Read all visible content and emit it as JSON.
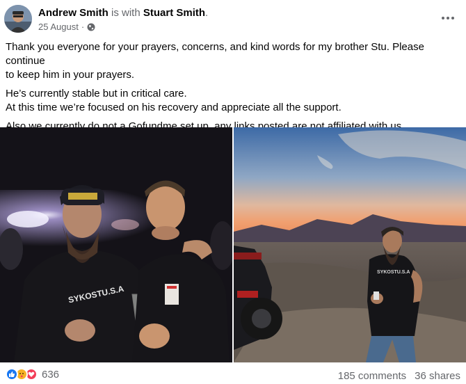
{
  "post": {
    "author": "Andrew Smith",
    "with_word": " is with ",
    "tagged": "Stuart Smith",
    "tagged_suffix": ".",
    "date": "25 August",
    "separator": "·",
    "privacy_icon": "globe-icon",
    "paragraphs": [
      [
        "Thank you everyone for your prayers, concerns, and kind words for my brother Stu. Please continue",
        "to keep him in your prayers."
      ],
      [
        "He’s currently stable but in critical care.",
        "At this time we’re focused on his recovery and appreciate all the support."
      ],
      [
        "Also we currently do not a Gofundme set up, any links posted are not affiliated with us."
      ]
    ],
    "photos": [
      {
        "name": "photo-two-men-night",
        "shirt_text": "SYKOSTU.S.A",
        "hat_text": "MILITARY VETERAN"
      },
      {
        "name": "photo-man-desert-sunset",
        "shirt_text": "SYKOSTU.S.A"
      }
    ]
  },
  "footer": {
    "reaction_count": "636",
    "comments": "185 comments",
    "shares": "36 shares",
    "reaction_icons": [
      "like-icon",
      "care-icon",
      "love-icon"
    ]
  },
  "colors": {
    "like": "#1877f2",
    "care": "#f7b125",
    "love": "#f33e58",
    "secondary_text": "#65676b"
  }
}
